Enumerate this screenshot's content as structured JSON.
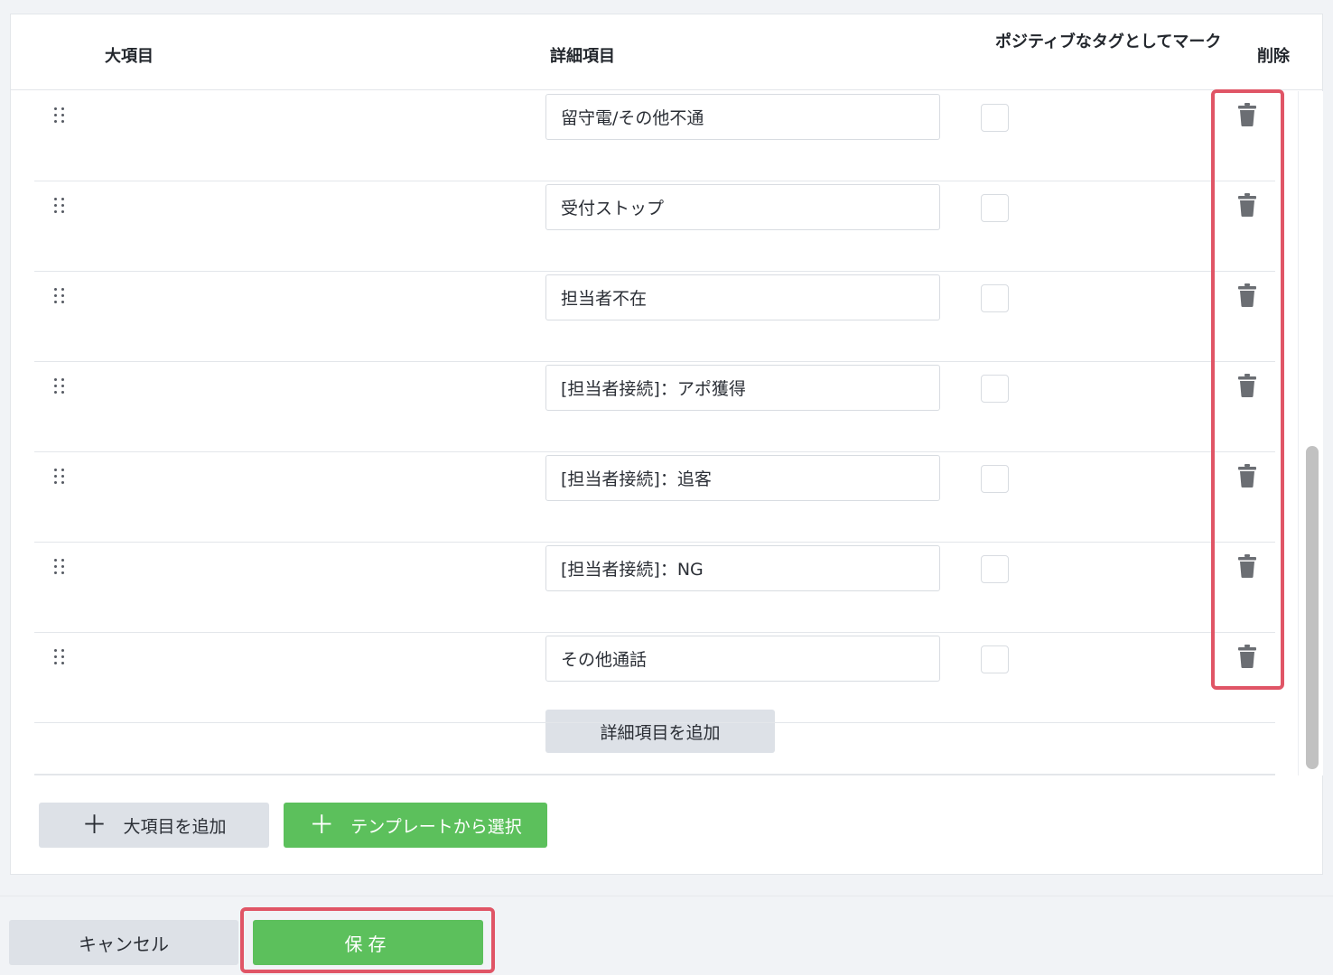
{
  "table": {
    "headers": {
      "category": "大項目",
      "detail": "詳細項目",
      "positive": "ポジティブなタグとしてマーク",
      "delete": "削除"
    },
    "rows": [
      {
        "detail": "留守電/その他不通",
        "positive": false
      },
      {
        "detail": "受付ストップ",
        "positive": false
      },
      {
        "detail": "担当者不在",
        "positive": false
      },
      {
        "detail": "[担当者接続]：アポ獲得",
        "positive": false
      },
      {
        "detail": "[担当者接続]：追客",
        "positive": false
      },
      {
        "detail": "[担当者接続]：NG",
        "positive": false
      },
      {
        "detail": "その他通話",
        "positive": false
      }
    ],
    "add_detail_label": "詳細項目を追加"
  },
  "actions": {
    "add_category_label": "大項目を追加",
    "template_label": "テンプレートから選択",
    "plus_glyph": "＋"
  },
  "footer": {
    "cancel_label": "キャンセル",
    "save_label": "保存"
  },
  "colors": {
    "accent_green": "#5cc05c",
    "highlight_red": "#e05566",
    "button_gray": "#dde1e7"
  },
  "icons": {
    "drag": "drag-handle-icon",
    "delete": "trash-icon",
    "add": "plus-icon"
  }
}
